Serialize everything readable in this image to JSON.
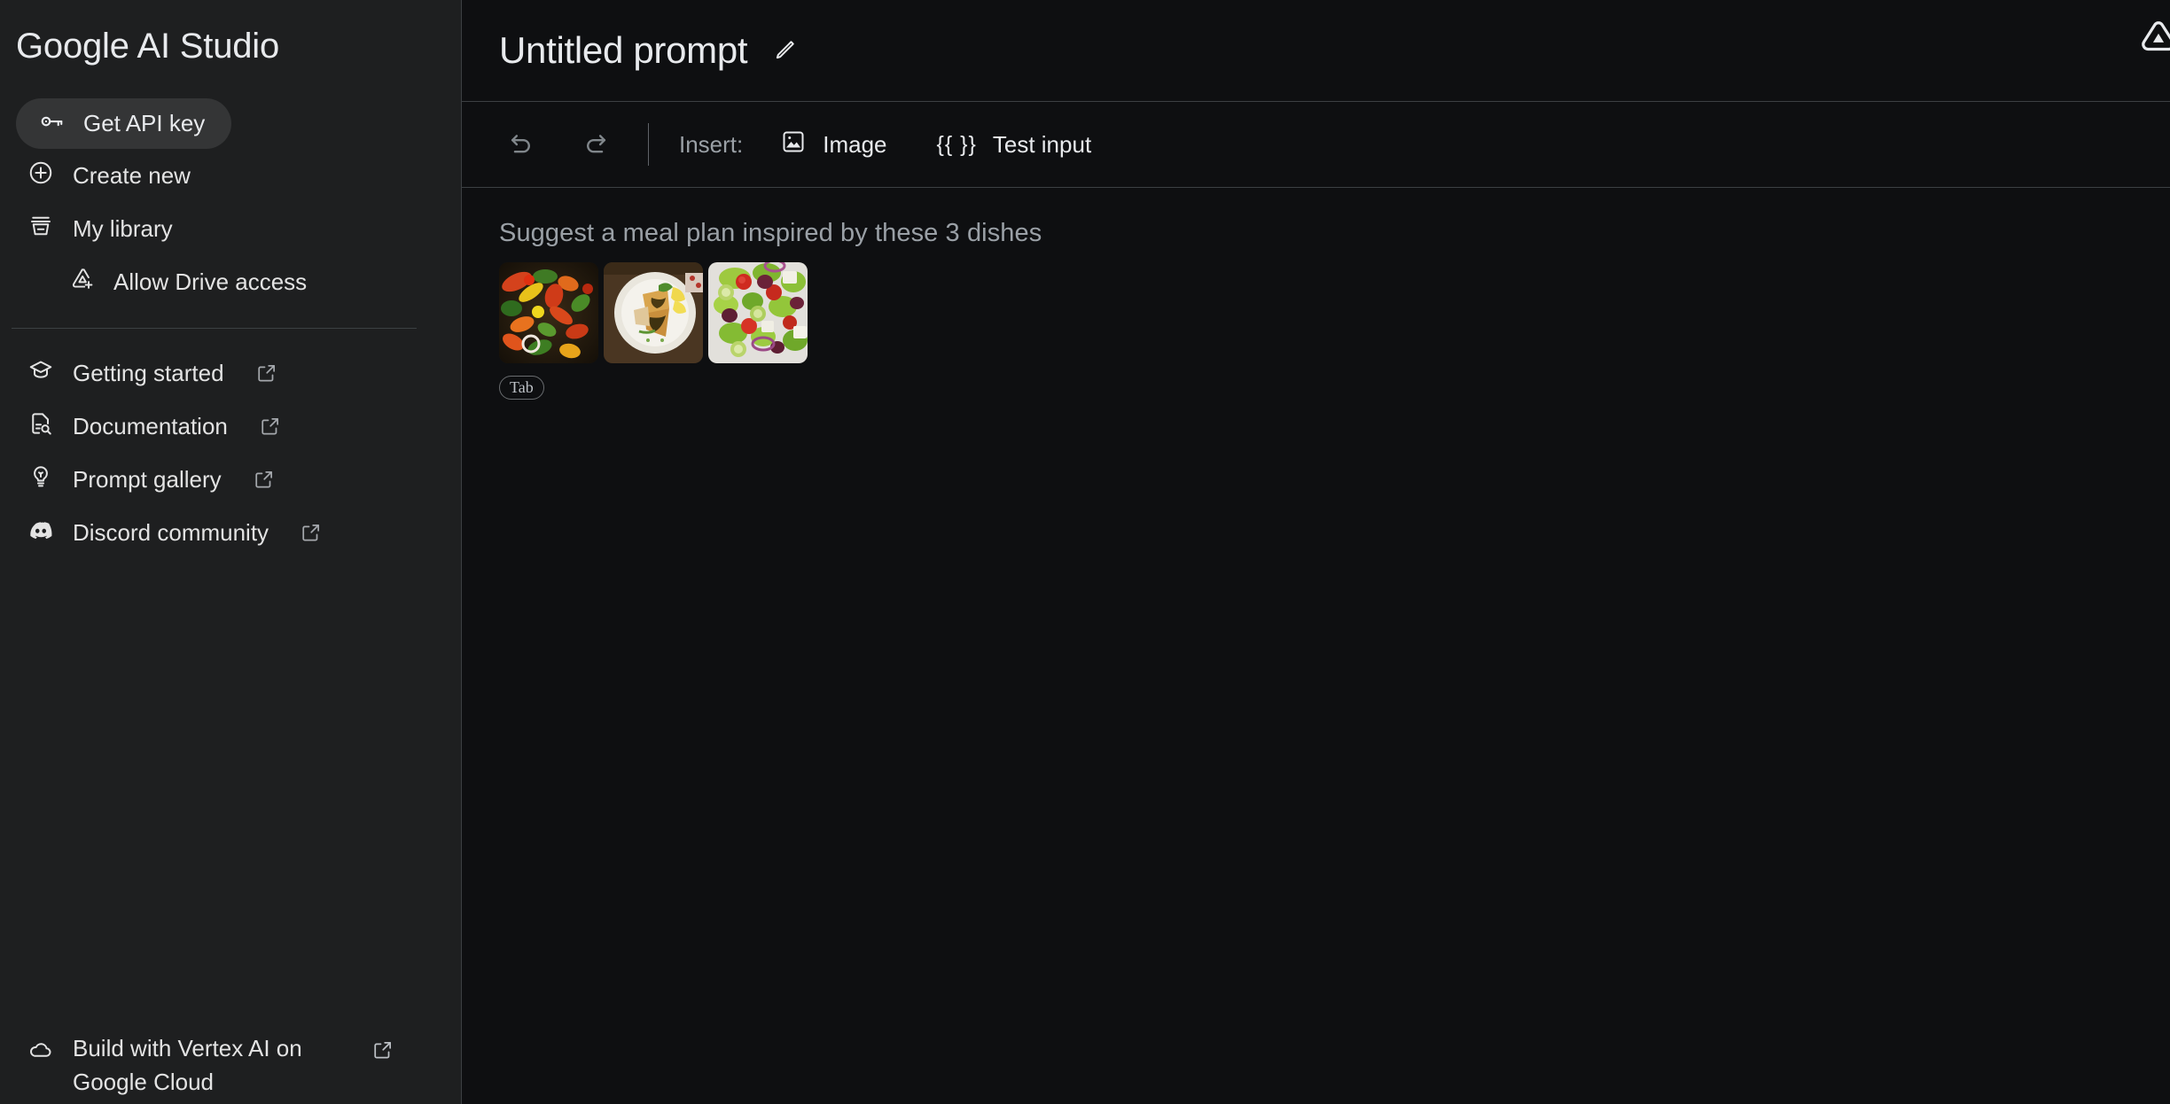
{
  "sidebar": {
    "brand": "Google AI Studio",
    "api_key_button": {
      "label": "Get API key",
      "icon": "key-icon"
    },
    "primary_items": [
      {
        "label": "Create new",
        "icon": "plus-circle-icon",
        "external": false,
        "sub": false
      },
      {
        "label": "My library",
        "icon": "library-icon",
        "external": false,
        "sub": false
      },
      {
        "label": "Allow Drive access",
        "icon": "drive-add-icon",
        "external": false,
        "sub": true
      }
    ],
    "secondary_items": [
      {
        "label": "Getting started",
        "icon": "graduation-cap-icon",
        "external": true
      },
      {
        "label": "Documentation",
        "icon": "document-search-icon",
        "external": true
      },
      {
        "label": "Prompt gallery",
        "icon": "lightbulb-icon",
        "external": true
      },
      {
        "label": "Discord community",
        "icon": "discord-icon",
        "external": true
      }
    ],
    "footer_item": {
      "label": "Build with Vertex AI on Google Cloud",
      "icon": "cloud-icon",
      "external": true
    }
  },
  "header": {
    "title": "Untitled prompt",
    "edit_icon": "pencil-icon",
    "corner_icon": "ai-studio-triangle-icon"
  },
  "toolbar": {
    "undo_icon": "undo-icon",
    "redo_icon": "redo-icon",
    "insert_label": "Insert:",
    "insert_image": {
      "label": "Image",
      "icon": "image-icon"
    },
    "insert_test_input": {
      "label": "Test input",
      "icon": "double-braces-icon",
      "glyph": "{{ }}"
    }
  },
  "editor": {
    "prompt_text": "Suggest a meal plan inspired by these 3 dishes",
    "thumbnails": [
      {
        "alt": "stir-fried mixed vegetables in a pan"
      },
      {
        "alt": "grilled chicken breast on a white plate with lemon"
      },
      {
        "alt": "greek salad with tomatoes, olives and feta"
      }
    ],
    "tab_hint": "Tab"
  },
  "colors": {
    "sidebar_bg": "#1e1f20",
    "main_bg": "#0e0f11",
    "border": "#3c4043",
    "text_primary": "#e8eaed",
    "text_secondary": "#9aa0a6",
    "pill_bg": "#343536"
  }
}
